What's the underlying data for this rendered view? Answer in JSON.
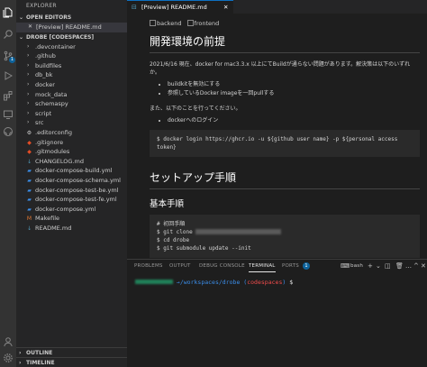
{
  "colors": {
    "accent": "#0e639c",
    "terminal_green": "#23d18b",
    "terminal_blue": "#3b8eea",
    "terminal_red": "#f14c4c"
  },
  "activity_bar": {
    "items": [
      "files-icon",
      "search-icon",
      "source-control-icon",
      "run-debug-icon",
      "extensions-icon",
      "remote-explorer-icon",
      "github-icon"
    ],
    "scm_badge": "1",
    "bottom": [
      "account-icon",
      "settings-gear-icon"
    ]
  },
  "explorer": {
    "title": "EXPLORER",
    "open_editors_label": "OPEN EDITORS",
    "open_editor_file": "[Preview] README.md",
    "workspace_label": "DROBE [CODESPACES]",
    "folders": [
      ".devcontainer",
      ".github",
      "buildfiles",
      "db_bk",
      "docker",
      "mock_data",
      "schemaspy",
      "script",
      "src"
    ],
    "files": [
      ".editorconfig",
      ".gitignore",
      ".gitmodules",
      "CHANGELOG.md",
      "docker-compose-build.yml",
      "docker-compose-schema.yml",
      "docker-compose-test-be.yml",
      "docker-compose-test-fe.yml",
      "docker-compose.yml",
      "Makefile",
      "README.md"
    ],
    "outline_label": "OUTLINE",
    "timeline_label": "TIMELINE"
  },
  "editor": {
    "tab_label": "[Preview] README.md",
    "badges": [
      "backend",
      "frontend"
    ],
    "h1_dev": "開発環境の前提",
    "p_intro": "2021/6/16 現在、docker for mac3.3.x 以上にてBuildが通らない問題があります。解決策は以下のいずれか。",
    "list_fix": [
      "buildkitを無効にする",
      "参照しているDocker imageを一回pullする"
    ],
    "p_also": "また、以下のことを行ってください。",
    "list_login": [
      "dockerへのログイン"
    ],
    "code_login": "$ docker login https://ghcr.io -u ${github user name} -p ${personal access token}",
    "h1_setup": "セットアップ手順",
    "h2_basic": "基本手順",
    "code_setup": {
      "comment": "# 初回手順",
      "clone": "$ git clone ",
      "cd": "$ cd drobe",
      "submodule": "$ git submodule update --init"
    }
  },
  "panel": {
    "tabs": [
      "PROBLEMS",
      "OUTPUT",
      "DEBUG CONSOLE",
      "TERMINAL",
      "PORTS"
    ],
    "ports_badge": "1",
    "shell_label": "bash",
    "prompt_path": "→/workspaces/drobe",
    "prompt_branch_open": "(",
    "prompt_branch": "codespaces",
    "prompt_branch_close": ")",
    "prompt_symbol": "$"
  }
}
